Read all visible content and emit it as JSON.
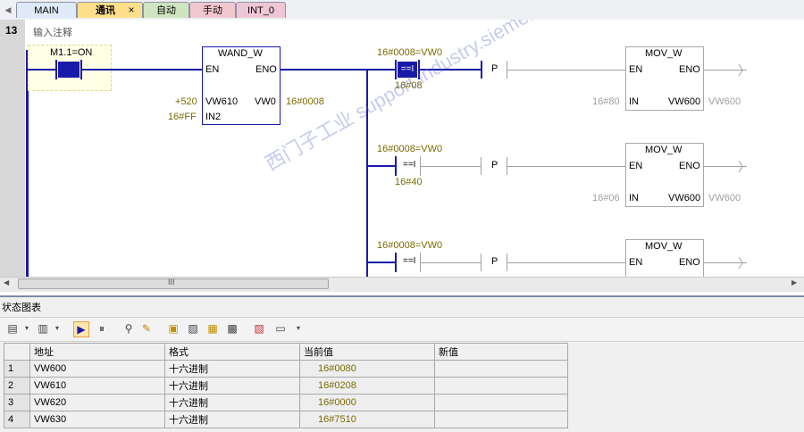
{
  "tabs": [
    {
      "label": "MAIN",
      "active": false
    },
    {
      "label": "通讯",
      "active": true
    },
    {
      "label": "自动",
      "active": false
    },
    {
      "label": "手动",
      "active": false
    },
    {
      "label": "INT_0",
      "active": false
    }
  ],
  "tab_close": "×",
  "network": {
    "number": "13",
    "comment": "输入注释",
    "contact_m11": "M1.1=ON",
    "wand": {
      "title": "WAND_W",
      "en": "EN",
      "eno": "ENO",
      "in1": "VW610",
      "in2": "IN2",
      "out": "VW0",
      "in1_val": "+520",
      "in2_val": "16#FF",
      "out_val": "16#0008"
    },
    "rungs": [
      {
        "compare_label": "16#0008=VW0",
        "op": "==I",
        "const": "16#08",
        "p": "P",
        "mov_title": "MOV_W",
        "en": "EN",
        "eno": "ENO",
        "in": "IN",
        "in_val": "16#80",
        "out": "VW600",
        "out_val": "VW600"
      },
      {
        "compare_label": "16#0008=VW0",
        "op": "==I",
        "const": "16#40",
        "p": "P",
        "mov_title": "MOV_W",
        "en": "EN",
        "eno": "ENO",
        "in": "IN",
        "in_val": "16#06",
        "out": "VW600",
        "out_val": "VW600"
      },
      {
        "compare_label": "16#0008=VW0",
        "op": "==I",
        "p": "P",
        "mov_title": "MOV_W",
        "en": "EN",
        "eno": "ENO"
      }
    ]
  },
  "scroll_grip": "III",
  "status_chart": {
    "title": "状态图表",
    "columns": [
      "地址",
      "格式",
      "当前值",
      "新值"
    ],
    "rows": [
      {
        "n": "1",
        "addr": "VW600",
        "fmt": "十六进制",
        "cur": "16#0080",
        "new": ""
      },
      {
        "n": "2",
        "addr": "VW610",
        "fmt": "十六进制",
        "cur": "16#0208",
        "new": ""
      },
      {
        "n": "3",
        "addr": "VW620",
        "fmt": "十六进制",
        "cur": "16#0000",
        "new": ""
      },
      {
        "n": "4",
        "addr": "VW630",
        "fmt": "十六进制",
        "cur": "16#7510",
        "new": ""
      }
    ]
  },
  "watermark": "西门子工业 support.industry.siemens.com/cs 技术论坛",
  "colors": {
    "wire_active": "#1a1aa8",
    "wire_inactive": "#a0a0a0",
    "value_text": "#7a6a00",
    "tab_active": "#ffe08a"
  }
}
